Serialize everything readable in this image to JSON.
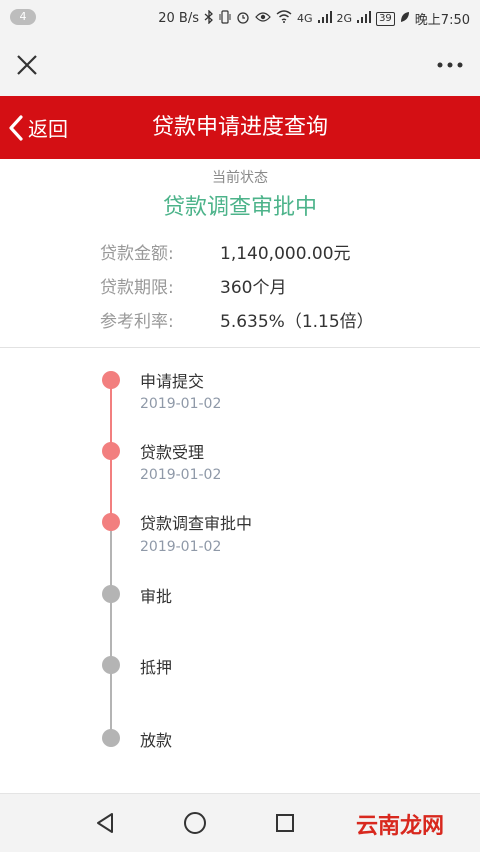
{
  "status_bar": {
    "notification_count": "4",
    "net_speed": "20 B/s",
    "signal1_tag": "4G",
    "signal2_tag": "2G",
    "battery": "39",
    "time": "晚上7:50"
  },
  "header": {
    "back_label": "返回",
    "title": "贷款申请进度查询"
  },
  "current_status": {
    "label": "当前状态",
    "value": "贷款调查审批中"
  },
  "loan_info": [
    {
      "key": "贷款金额:",
      "value": "1,140,000.00元"
    },
    {
      "key": "贷款期限:",
      "value": "360个月"
    },
    {
      "key": "参考利率:",
      "value": "5.635%（1.15倍）"
    }
  ],
  "timeline": [
    {
      "name": "申请提交",
      "date": "2019-01-02",
      "done": true
    },
    {
      "name": "贷款受理",
      "date": "2019-01-02",
      "done": true
    },
    {
      "name": "贷款调查审批中",
      "date": "2019-01-02",
      "done": true
    },
    {
      "name": "审批",
      "date": "",
      "done": false
    },
    {
      "name": "抵押",
      "date": "",
      "done": false
    },
    {
      "name": "放款",
      "date": "",
      "done": false
    }
  ],
  "watermark": "云南龙网",
  "colors": {
    "header_red": "#d40f14",
    "status_green": "#4cb38a",
    "done_dot": "#f27f7f",
    "todo_dot": "#b4b4b4"
  }
}
